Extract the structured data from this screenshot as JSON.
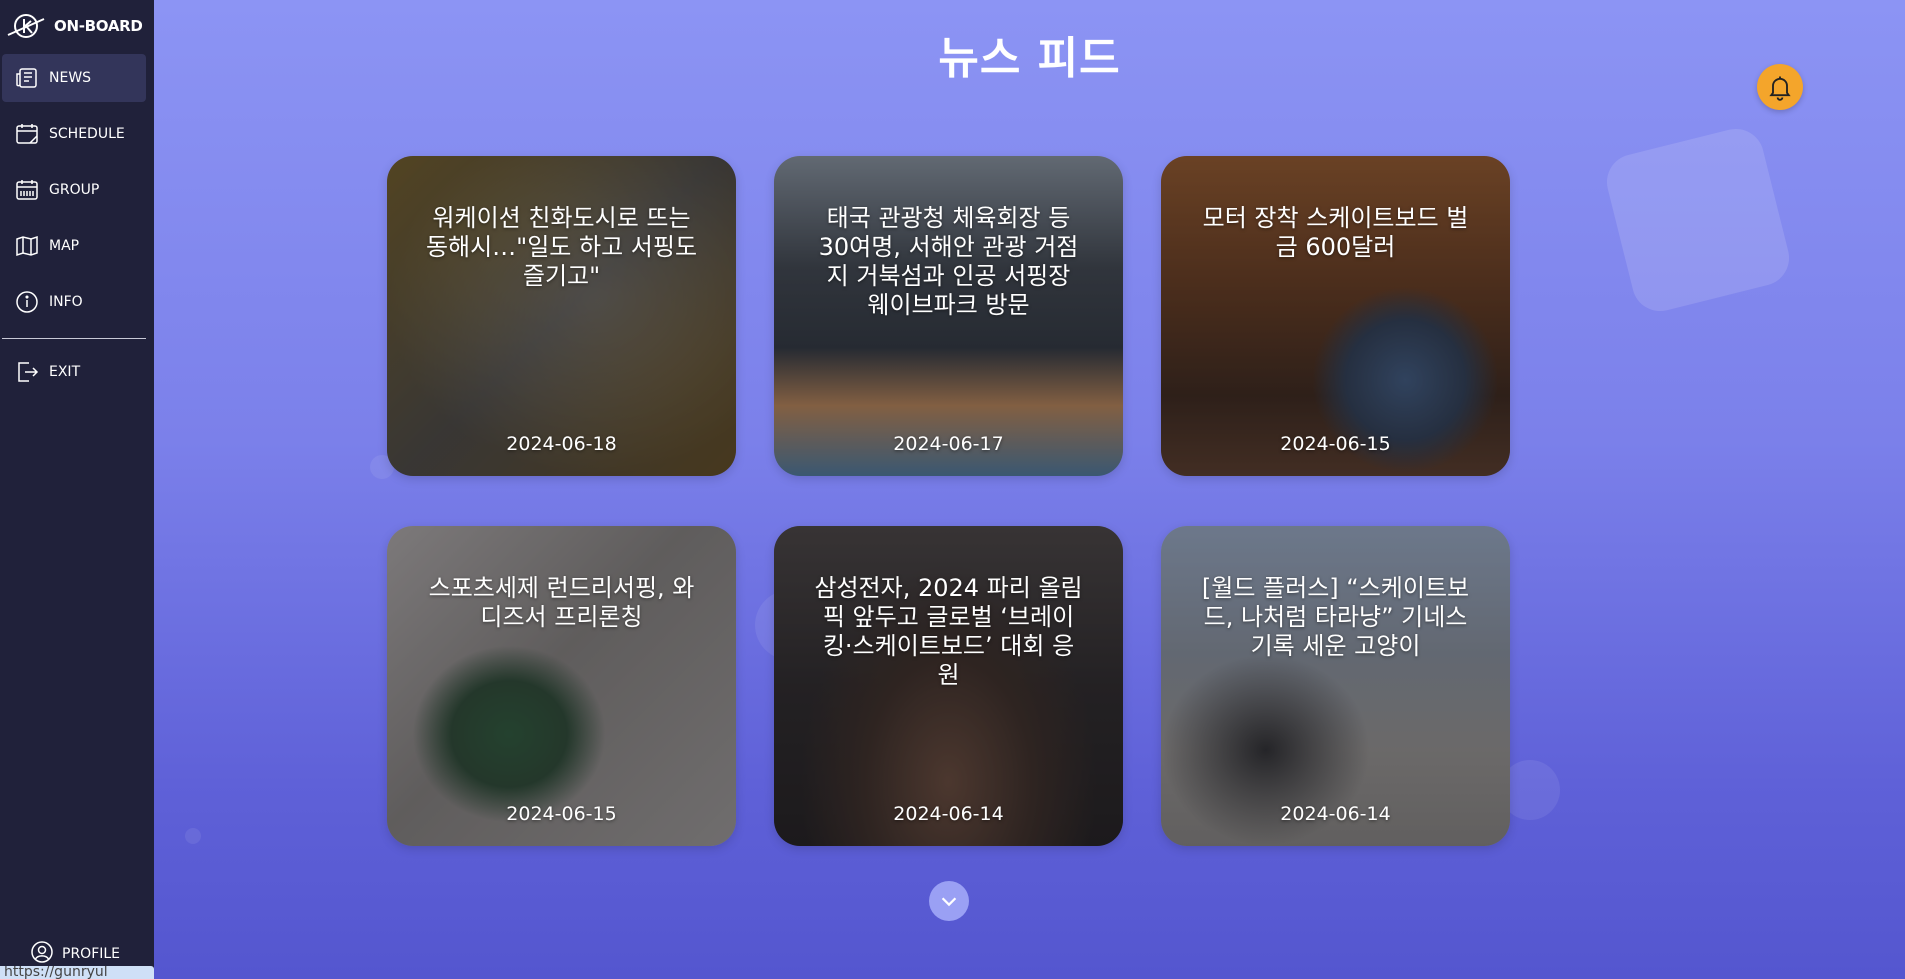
{
  "app": {
    "logo_text": "ON-BOARD"
  },
  "sidebar": {
    "items": [
      {
        "label": "NEWS",
        "icon": "newspaper-icon",
        "active": true
      },
      {
        "label": "SCHEDULE",
        "icon": "calendar-icon",
        "active": false
      },
      {
        "label": "GROUP",
        "icon": "group-calendar-icon",
        "active": false
      },
      {
        "label": "MAP",
        "icon": "map-icon",
        "active": false
      },
      {
        "label": "INFO",
        "icon": "info-icon",
        "active": false
      }
    ],
    "exit_label": "EXIT",
    "profile_label": "PROFILE"
  },
  "status_bar": {
    "url": "https://gunryul"
  },
  "main": {
    "page_title": "뉴스 피드",
    "notification_icon": "bell-icon",
    "scroll_icon": "chevron-down-icon",
    "accent_color": "#f4a52b",
    "news": [
      {
        "title": "워케이션 친화도시로 뜨는 동해시…\"일도 하고 서핑도 즐기고\"",
        "date": "2024-06-18"
      },
      {
        "title": "태국 관광청 체육회장 등 30여명, 서해안 관광 거점지 거북섬과 인공 서핑장 웨이브파크 방문",
        "date": "2024-06-17"
      },
      {
        "title": "모터 장착 스케이트보드 벌금 600달러",
        "date": "2024-06-15"
      },
      {
        "title": "스포츠세제 런드리서핑, 와디즈서 프리론칭",
        "date": "2024-06-15"
      },
      {
        "title": "삼성전자, 2024 파리 올림픽 앞두고 글로벌 ‘브레이킹·스케이트보드’ 대회 응원",
        "date": "2024-06-14"
      },
      {
        "title": "[월드 플러스] “스케이트보드, 나처럼 타라냥” 기네스 기록 세운 고양이",
        "date": "2024-06-14"
      }
    ]
  }
}
